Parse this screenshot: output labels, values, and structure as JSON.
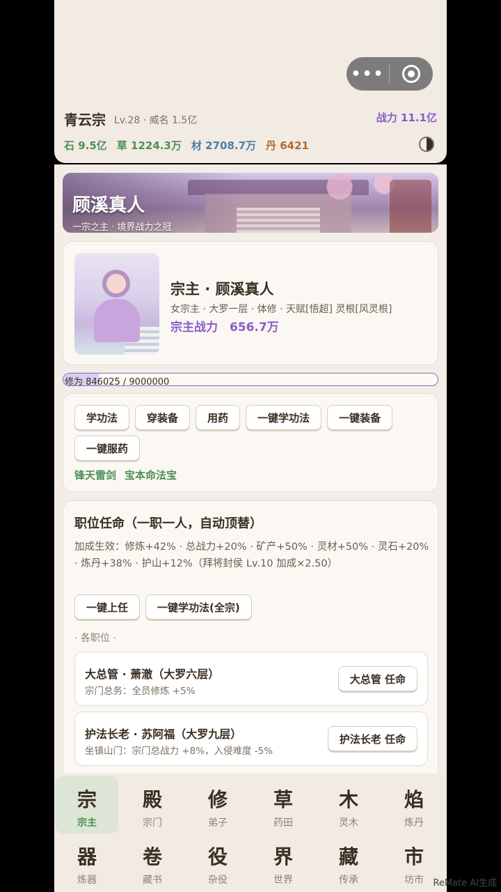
{
  "top": {
    "sect_name": "青云宗",
    "sect_meta": "Lv.28 · 威名 1.5亿",
    "power": "战力 11.1亿",
    "resources": {
      "stone": "石 9.5亿",
      "grass": "草 1224.3万",
      "wood": "材 2708.7万",
      "pill": "丹 6421"
    }
  },
  "banner": {
    "title": "顾溪真人",
    "subtitle": "一宗之主 · 境界战力之冠"
  },
  "leader": {
    "name": "宗主 · 顾溪真人",
    "desc": "女宗主 · 大罗一层 · 体修 · 天赋[悟超] 灵根[风灵根]",
    "power": "宗主战力　656.7万"
  },
  "cultivation": {
    "text": "修为 846025 / 9000000",
    "progress": 0.094
  },
  "actions": {
    "buttons": [
      "学功法",
      "穿装备",
      "用药",
      "一键学功法",
      "一键装备",
      "一键服药"
    ],
    "equipment": [
      "锋天雷剑",
      "宝本命法宝"
    ]
  },
  "posts": {
    "title": "职位任命（一职一人，自动顶替）",
    "bonus": "加成生效：修炼+42% · 总战力+20% · 矿产+50% · 灵材+50% · 灵石+20% · 炼丹+38% · 护山+12%（拜将封侯 Lv.10 加成×2.50）",
    "btn_appoint_all": "一键上任",
    "btn_learn_all": "一键学功法(全宗)",
    "section": "· 各职位 ·",
    "items": [
      {
        "title": "大总管 · 萧澈（大罗六层）",
        "desc": "宗门总务：全员修炼 +5%",
        "button": "大总管 任命"
      },
      {
        "title": "护法长老 · 苏阿福（大罗九层）",
        "desc": "坐镇山门：宗门总战力 +8%，入侵难度 -5%",
        "button": "护法长老 任命"
      }
    ]
  },
  "nav": [
    {
      "glyph": "宗",
      "label": "宗主",
      "active": true
    },
    {
      "glyph": "殿",
      "label": "宗门"
    },
    {
      "glyph": "修",
      "label": "弟子"
    },
    {
      "glyph": "草",
      "label": "药田"
    },
    {
      "glyph": "木",
      "label": "灵木"
    },
    {
      "glyph": "焰",
      "label": "炼丹"
    },
    {
      "glyph": "器",
      "label": "炼器"
    },
    {
      "glyph": "卷",
      "label": "藏书"
    },
    {
      "glyph": "役",
      "label": "杂役"
    },
    {
      "glyph": "界",
      "label": "世界"
    },
    {
      "glyph": "藏",
      "label": "传承"
    },
    {
      "glyph": "市",
      "label": "坊市"
    }
  ],
  "watermark": "ReMate AI生成",
  "icons": {
    "menu": "more-dots-icon",
    "close": "record-icon",
    "taiji": "yin-yang-icon"
  }
}
